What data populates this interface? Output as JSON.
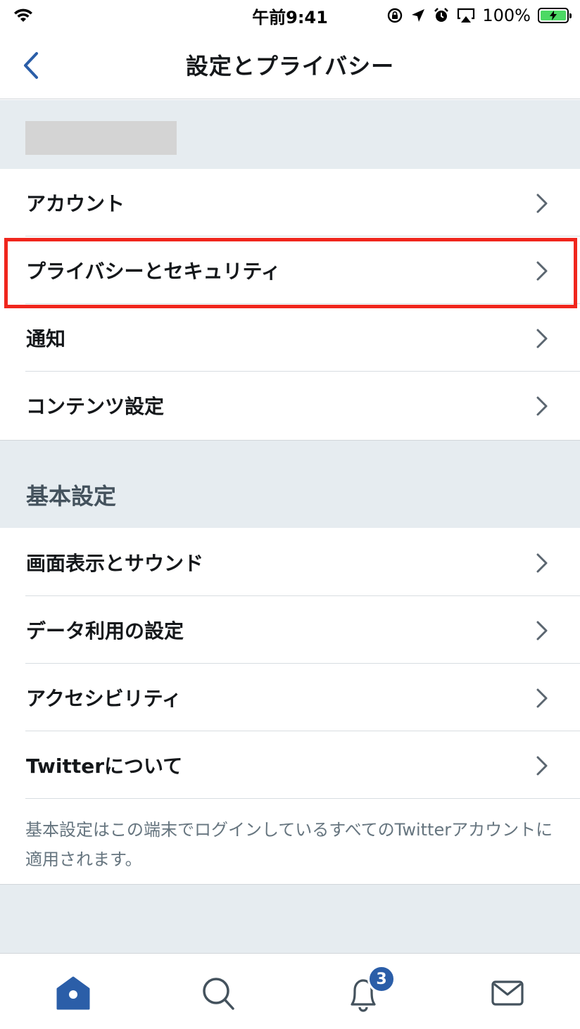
{
  "status_bar": {
    "time": "午前9:41",
    "battery_percent": "100%",
    "icons": [
      "wifi-icon",
      "rotation-lock-icon",
      "location-icon",
      "alarm-icon",
      "airplay-icon",
      "battery-charging-icon"
    ]
  },
  "nav": {
    "title": "設定とプライバシー",
    "back_icon": "chevron-left-icon"
  },
  "account_section": {
    "items": [
      {
        "label": "アカウント"
      },
      {
        "label": "プライバシーとセキュリティ",
        "highlighted": true
      },
      {
        "label": "通知"
      },
      {
        "label": "コンテンツ設定"
      }
    ]
  },
  "general_section": {
    "title": "基本設定",
    "items": [
      {
        "label": "画面表示とサウンド"
      },
      {
        "label": "データ利用の設定"
      },
      {
        "label": "アクセシビリティ"
      },
      {
        "label": "Twitterについて"
      }
    ],
    "footnote": "基本設定はこの端末でログインしているすべてのTwitterアカウントに適用されます。"
  },
  "tab_bar": {
    "tabs": [
      {
        "name": "home",
        "icon": "home-icon",
        "active": true
      },
      {
        "name": "search",
        "icon": "search-icon"
      },
      {
        "name": "notifications",
        "icon": "bell-icon"
      },
      {
        "name": "messages",
        "icon": "envelope-icon"
      }
    ],
    "notification_badge": "3"
  },
  "colors": {
    "accent": "#2b5ea8",
    "section_background": "#e6ecf0",
    "highlight_border": "#f0261d",
    "battery_fill": "#4cd964"
  }
}
